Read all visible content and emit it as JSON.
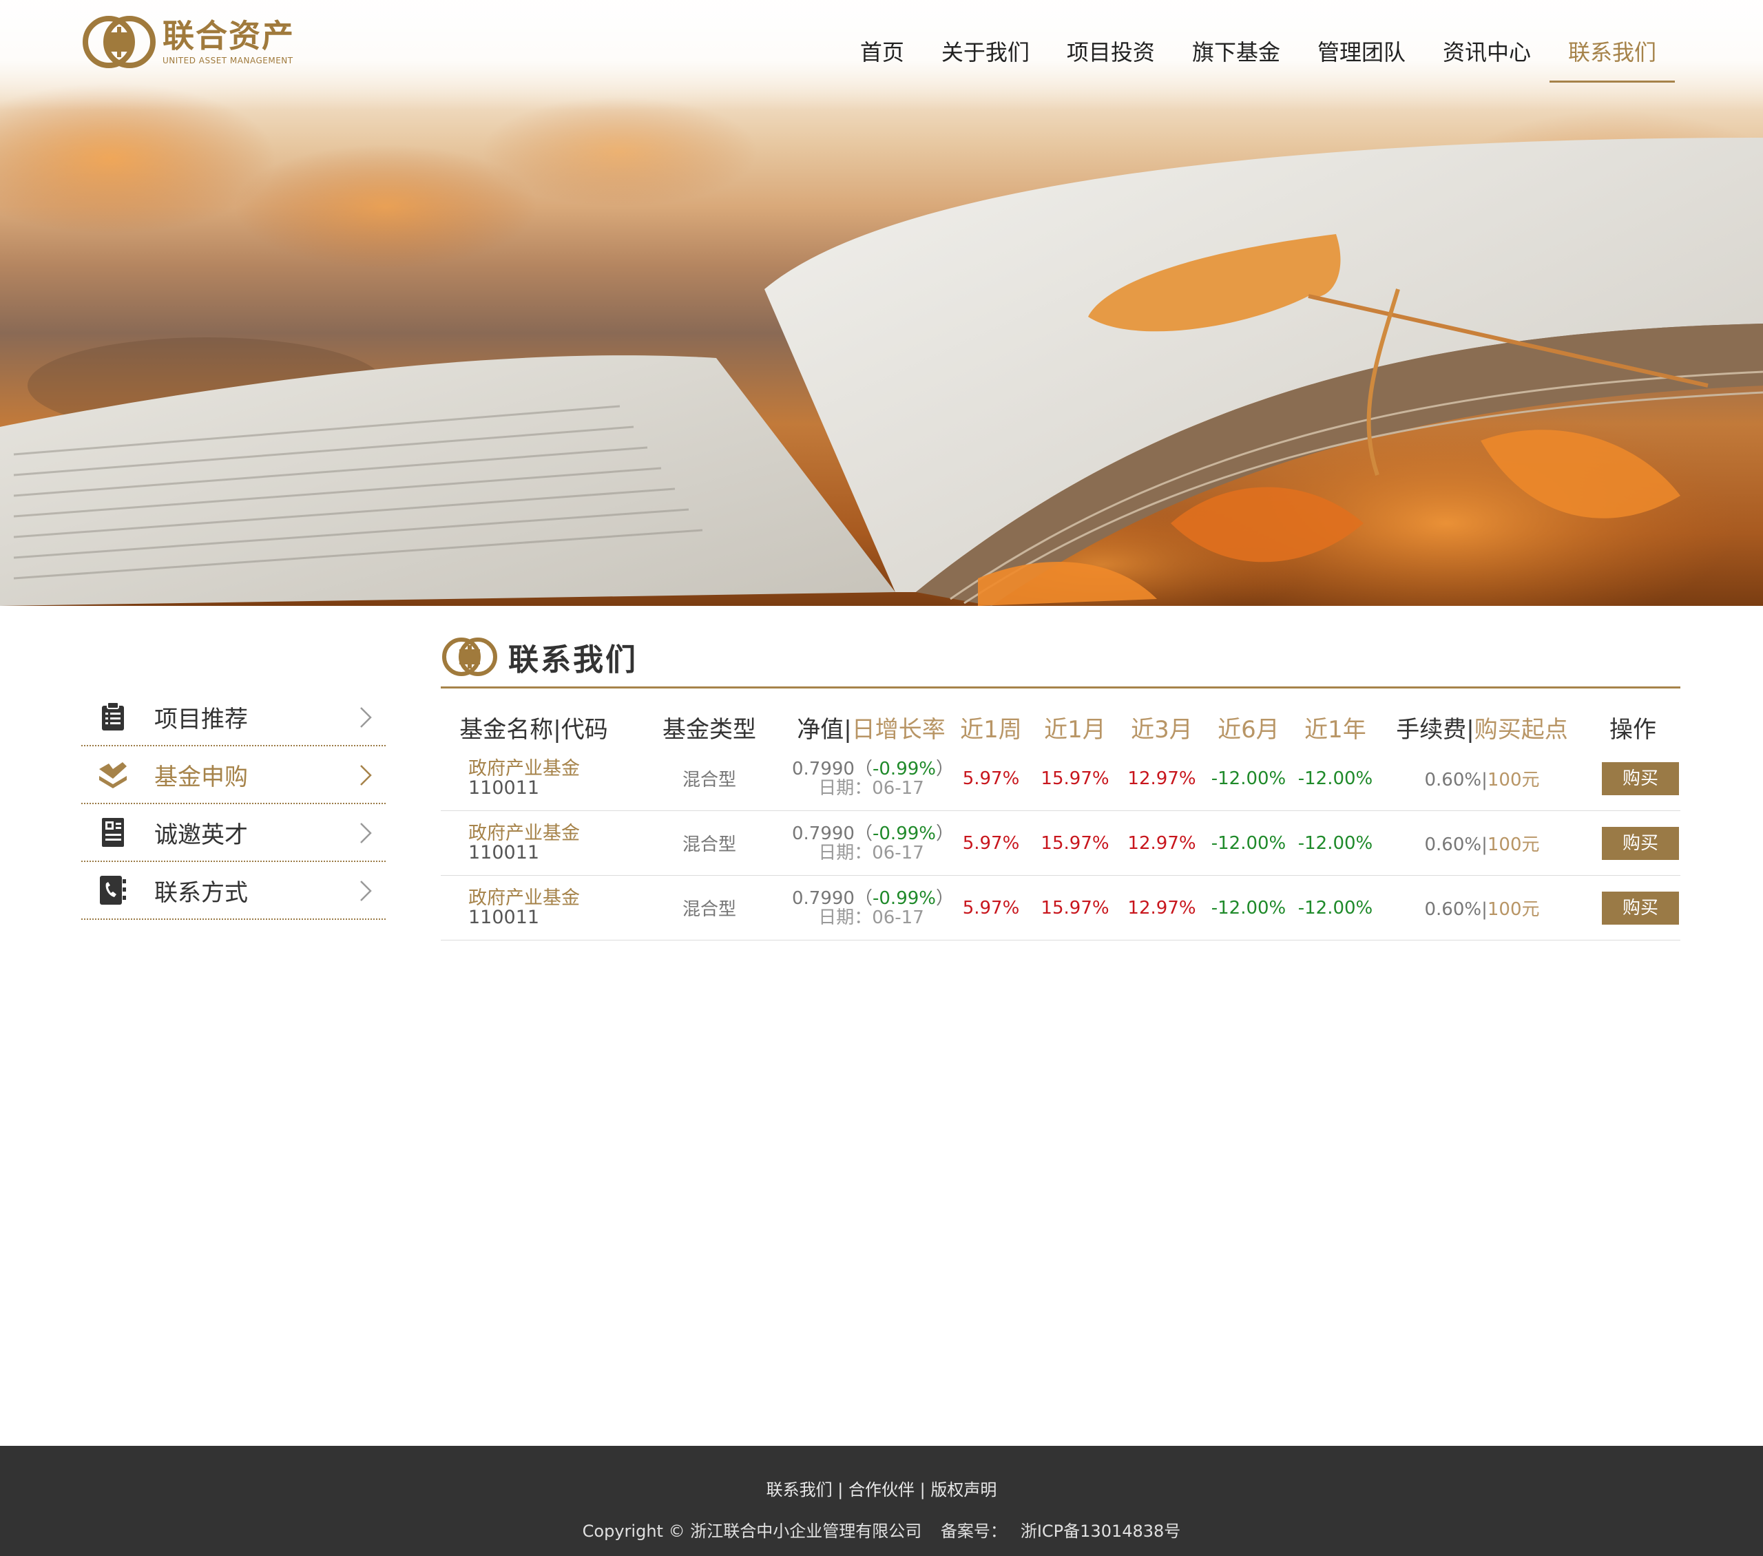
{
  "header": {
    "logo_cn": "联合资产",
    "logo_en": "UNITED  ASSET  MANAGEMENT",
    "nav": [
      {
        "label": "首页"
      },
      {
        "label": "关于我们"
      },
      {
        "label": "项目投资"
      },
      {
        "label": "旗下基金"
      },
      {
        "label": "管理团队"
      },
      {
        "label": "资讯中心"
      },
      {
        "label": "联系我们",
        "active": true
      }
    ]
  },
  "sidebar": {
    "items": [
      {
        "label": "项目推荐",
        "icon": "clipboard-icon"
      },
      {
        "label": "基金申购",
        "icon": "layers-check-icon",
        "active": true
      },
      {
        "label": "诚邀英才",
        "icon": "resume-icon"
      },
      {
        "label": "联系方式",
        "icon": "phone-book-icon"
      }
    ]
  },
  "main": {
    "title": "联系我们",
    "table": {
      "headers": {
        "name": "基金名称",
        "code": "代码",
        "type": "基金类型",
        "nav": "净值",
        "daily": "日增长率",
        "w1": "近1周",
        "m1": "近1月",
        "m3": "近3月",
        "m6": "近6月",
        "y1": "近1年",
        "fee": "手续费",
        "min": "购买起点",
        "op": "操作"
      },
      "rows": [
        {
          "name": "政府产业基金",
          "code": "110011",
          "type": "混合型",
          "nav": "0.7990",
          "change": "-0.99%",
          "date_label": "日期：",
          "date": "06-17",
          "w1": "5.97%",
          "m1": "15.97%",
          "m3": "12.97%",
          "m6": "-12.00%",
          "y1": "-12.00%",
          "fee": "0.60%",
          "min": "100元",
          "button": "购买"
        },
        {
          "name": "政府产业基金",
          "code": "110011",
          "type": "混合型",
          "nav": "0.7990",
          "change": "-0.99%",
          "date_label": "日期：",
          "date": "06-17",
          "w1": "5.97%",
          "m1": "15.97%",
          "m3": "12.97%",
          "m6": "-12.00%",
          "y1": "-12.00%",
          "fee": "0.60%",
          "min": "100元",
          "button": "购买"
        },
        {
          "name": "政府产业基金",
          "code": "110011",
          "type": "混合型",
          "nav": "0.7990",
          "change": "-0.99%",
          "date_label": "日期：",
          "date": "06-17",
          "w1": "5.97%",
          "m1": "15.97%",
          "m3": "12.97%",
          "m6": "-12.00%",
          "y1": "-12.00%",
          "fee": "0.60%",
          "min": "100元",
          "button": "购买"
        }
      ]
    }
  },
  "footer": {
    "links": [
      "联系我们",
      "合作伙伴",
      "版权声明"
    ],
    "copyright": "Copyright © 浙江联合中小企业管理有限公司",
    "icp_label": "备案号：",
    "icp": "浙ICP备13014838号"
  },
  "colors": {
    "accent": "#a6834a",
    "button": "#9a7a46",
    "positive": "#c8161d",
    "negative": "#1f8a2a",
    "footer_bg": "#333333"
  }
}
